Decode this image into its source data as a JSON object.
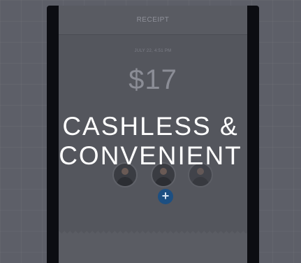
{
  "receipt": {
    "title": "RECEIPT",
    "date": "JULY 22, 4:51 PM",
    "amount": "$17",
    "add_button_label": "+"
  },
  "headline": {
    "line1": "CASHLESS &",
    "line2": "CONVENIENT"
  },
  "colors": {
    "accent": "#1c4f82",
    "background": "#5d5f68",
    "phone_frame": "#0c0d12"
  }
}
